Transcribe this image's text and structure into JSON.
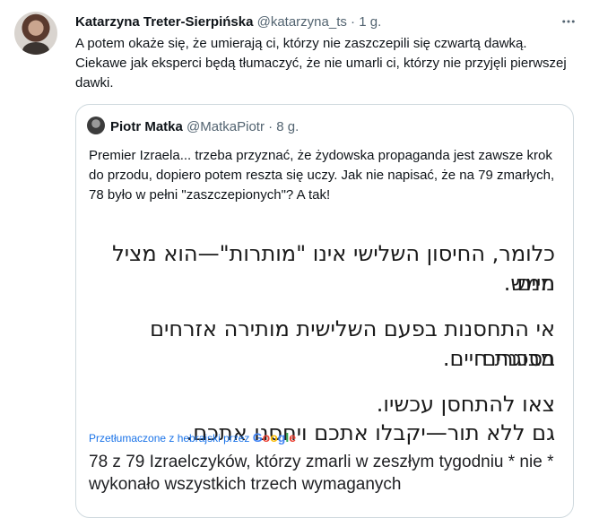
{
  "tweet": {
    "author_name": "Katarzyna Treter-Sierpińska",
    "author_handle": "@katarzyna_ts",
    "separator": "·",
    "time": "1 g.",
    "more_icon": "ellipsis-horizontal-icon",
    "text": "A potem okaże się, że umierają ci, którzy nie zaszczepili się czwartą dawką. Ciekawe jak eksperci będą tłumaczyć, że nie umarli ci, którzy nie przyjęli pierwszej dawki."
  },
  "quoted": {
    "author_name": "Piotr Matka",
    "author_handle": "@MatkaPiotr",
    "separator": "·",
    "time": "8 g.",
    "text": "Premier Izraela... trzeba przyznać, że żydowska propaganda jest zawsze krok do przodu, dopiero potem reszta się uczy. Jak nie napisać, że na 79 zmarłych, 78 było w pełni \"zaszczepionych\"? A tak!",
    "image": {
      "hebrew_lines": [
        "כלומר, החיסון השלישי אינו \"מותרות\"—הוא מציל חיים",
        "ממש.",
        "אי התחסנות בפעם השלישית מותירה אזרחים מבוגרים",
        "בסכנת חיים.",
        "צאו להתחסן עכשיו.",
        "גם ללא תור—יקבלו אתכם ויחסנו אתכם."
      ],
      "translated_label": "Przetłumaczone z hebrajski przez",
      "google_logo": "Google",
      "translated_text": "78 z 79 Izraelczyków, którzy zmarli w zeszłym tygodniu * nie * wykonało wszystkich trzech wymaganych"
    }
  },
  "colors": {
    "text": "#0f1419",
    "secondary": "#536471",
    "border": "#cfd9de",
    "link": "#1a73e8"
  }
}
